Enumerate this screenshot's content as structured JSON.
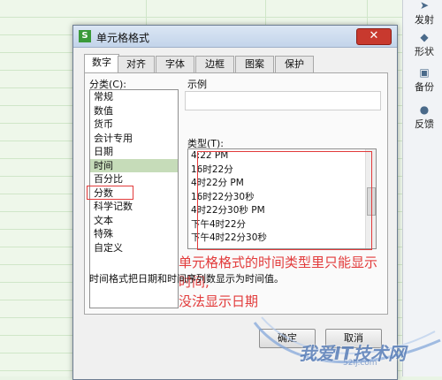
{
  "dialog": {
    "title": "单元格格式",
    "close_symbol": "✕",
    "tabs": [
      {
        "label": "数字"
      },
      {
        "label": "对齐"
      },
      {
        "label": "字体"
      },
      {
        "label": "边框"
      },
      {
        "label": "图案"
      },
      {
        "label": "保护"
      }
    ],
    "category_label": "分类(C):",
    "categories": [
      "常规",
      "数值",
      "货币",
      "会计专用",
      "日期",
      "时间",
      "百分比",
      "分数",
      "科学记数",
      "文本",
      "特殊",
      "自定义"
    ],
    "selected_category": "时间",
    "sample_label": "示例",
    "type_label": "类型(T):",
    "types": [
      "4:22 PM",
      "16时22分",
      "4时22分 PM",
      "16时22分30秒",
      "4时22分30秒 PM",
      "下午4时22分",
      "下午4时22分30秒"
    ],
    "description": "时间格式把日期和时间序列数显示为时间值。",
    "ok_label": "确定",
    "cancel_label": "取消"
  },
  "annotation": {
    "line1": "单元格格式的时间类型里只能显示时间,",
    "line2": "没法显示日期"
  },
  "side_panel": {
    "items": [
      {
        "label": "发射",
        "icon": "share-icon"
      },
      {
        "label": "形状",
        "icon": "shape-icon"
      },
      {
        "label": "备份",
        "icon": "backup-icon"
      },
      {
        "label": "反馈",
        "icon": "feedback-icon"
      }
    ]
  },
  "watermark": {
    "text": "我爱IT技术网",
    "url": "52ij.com"
  },
  "colors": {
    "annotation_red": "#e23b3b",
    "selection_green": "#c6dcb9",
    "sheet_green": "#eef7ea"
  }
}
